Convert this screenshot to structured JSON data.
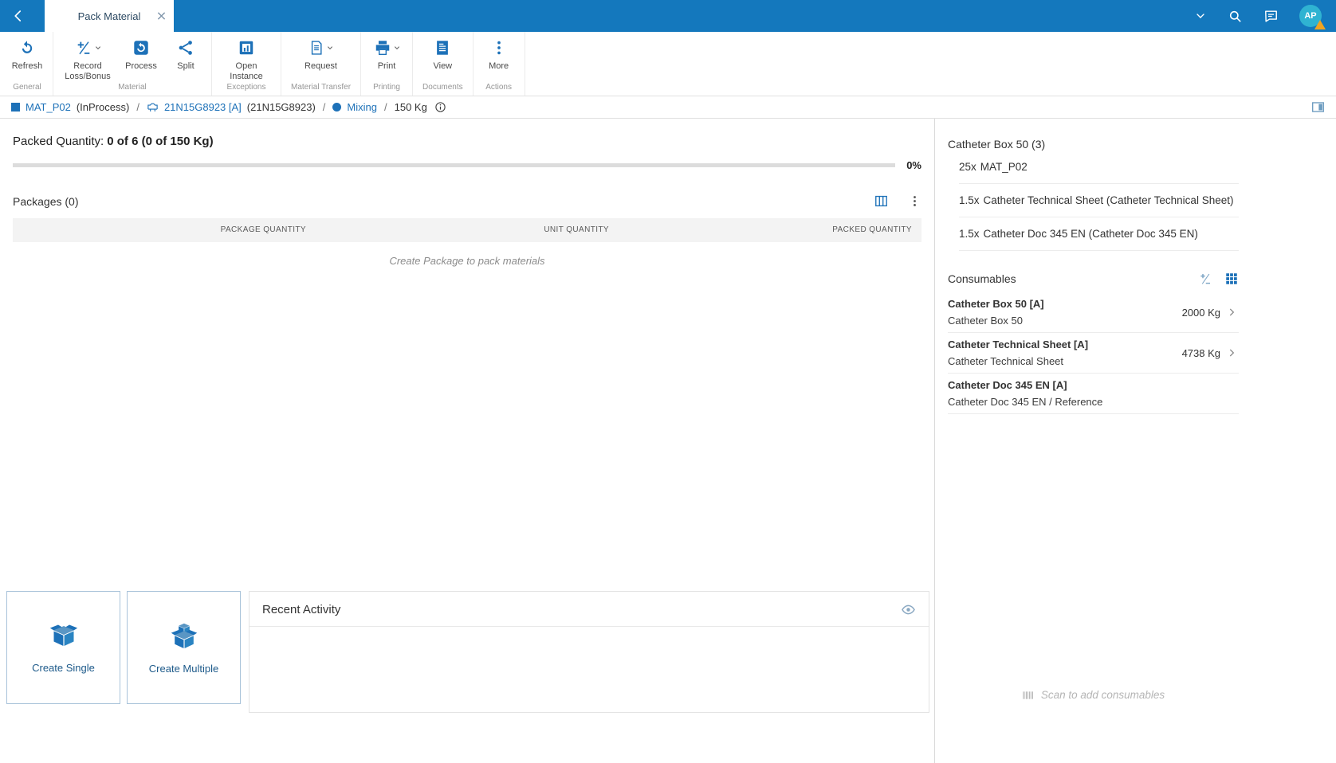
{
  "topbar": {
    "tab_title": "Pack Material",
    "avatar_initials": "AP"
  },
  "ribbon": {
    "groups": [
      {
        "label": "General",
        "buttons": [
          {
            "label": "Refresh"
          }
        ]
      },
      {
        "label": "Material",
        "buttons": [
          {
            "label": "Record Loss/Bonus",
            "dropdown": true
          },
          {
            "label": "Process"
          },
          {
            "label": "Split"
          }
        ]
      },
      {
        "label": "Exceptions",
        "buttons": [
          {
            "label": "Open Instance"
          }
        ]
      },
      {
        "label": "Material Transfer",
        "buttons": [
          {
            "label": "Request",
            "dropdown": true
          }
        ]
      },
      {
        "label": "Printing",
        "buttons": [
          {
            "label": "Print",
            "dropdown": true
          }
        ]
      },
      {
        "label": "Documents",
        "buttons": [
          {
            "label": "View"
          }
        ]
      },
      {
        "label": "Actions",
        "buttons": [
          {
            "label": "More"
          }
        ]
      }
    ]
  },
  "breadcrumb": {
    "sep": "/",
    "material_name": "MAT_P02",
    "material_state": "(InProcess)",
    "equipment_name": "21N15G8923 [A]",
    "equipment_alt": "(21N15G8923)",
    "step_name": "Mixing",
    "quantity": "150 Kg"
  },
  "packed_quantity": {
    "label": "Packed Quantity:",
    "value": "0 of 6 (0 of 150 Kg)",
    "percent_label": "0%",
    "percent": 0
  },
  "packages": {
    "title": "Packages (0)",
    "columns": [
      "PACKAGE QUANTITY",
      "UNIT QUANTITY",
      "PACKED QUANTITY"
    ],
    "empty_message": "Create Package to pack materials"
  },
  "create_actions": {
    "single_label": "Create Single",
    "multiple_label": "Create Multiple"
  },
  "recent_activity": {
    "title": "Recent Activity"
  },
  "sidebar": {
    "bom": {
      "title": "Catheter Box 50 (3)",
      "items": [
        {
          "qty": "25x",
          "name": "MAT_P02"
        },
        {
          "qty": "1.5x",
          "name": "Catheter Technical Sheet (Catheter Technical Sheet)"
        },
        {
          "qty": "1.5x",
          "name": "Catheter Doc 345 EN (Catheter Doc 345 EN)"
        }
      ]
    },
    "consumables": {
      "title": "Consumables",
      "items": [
        {
          "name": "Catheter Box 50 [A]",
          "subtitle": "Catheter Box 50",
          "quantity": "2000 Kg"
        },
        {
          "name": "Catheter Technical Sheet [A]",
          "subtitle": "Catheter Technical Sheet",
          "quantity": "4738 Kg"
        },
        {
          "name": "Catheter Doc 345 EN [A]",
          "subtitle": "Catheter Doc 345 EN / Reference",
          "quantity": ""
        }
      ],
      "scan_hint": "Scan to add consumables"
    }
  },
  "colors": {
    "topbar_blue": "#1478bd",
    "icon_blue": "#1d71b8",
    "avatar_teal": "#2fb3d2",
    "warning_orange": "#f0a422"
  }
}
